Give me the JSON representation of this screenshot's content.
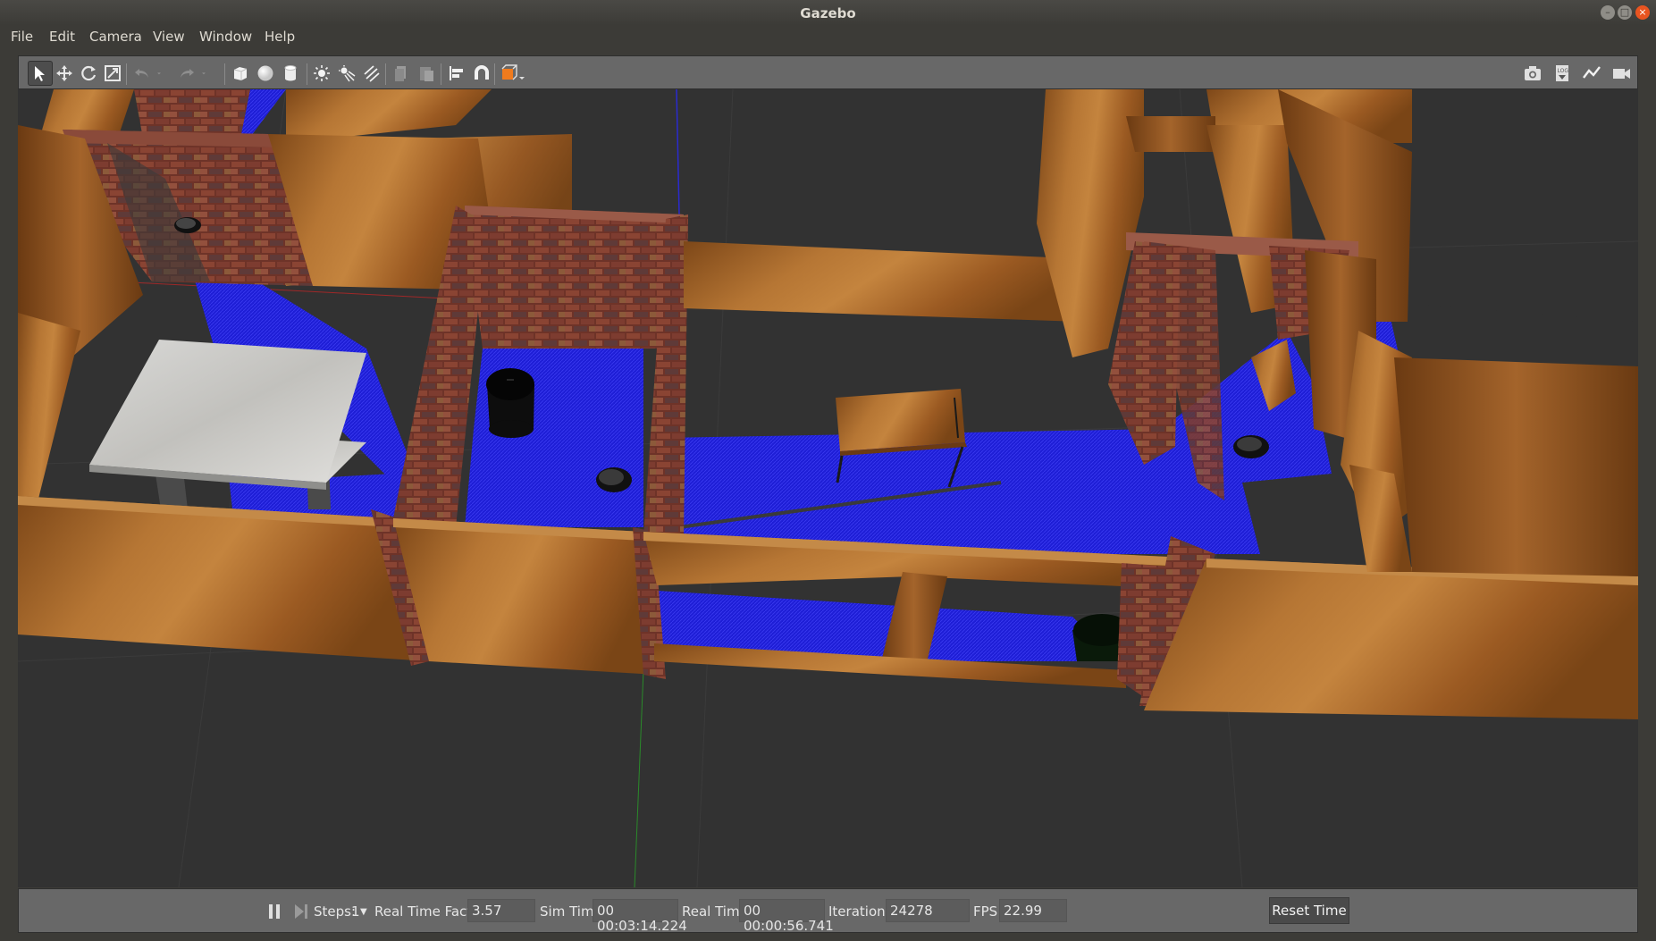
{
  "window": {
    "title": "Gazebo",
    "controls": [
      "minimize-icon",
      "maximize-icon",
      "close-icon"
    ]
  },
  "menu": [
    {
      "label": "File"
    },
    {
      "label": "Edit"
    },
    {
      "label": "Camera"
    },
    {
      "label": "View"
    },
    {
      "label": "Window"
    },
    {
      "label": "Help"
    }
  ],
  "toolbar": {
    "left_tools": [
      "select-arrow-icon",
      "translate-icon",
      "rotate-icon",
      "scale-icon",
      "undo-icon",
      "undo-dropdown-icon",
      "redo-icon",
      "redo-dropdown-icon",
      "box-shape-icon",
      "sphere-shape-icon",
      "cylinder-shape-icon",
      "point-light-icon",
      "spot-light-icon",
      "directional-light-icon",
      "copy-icon",
      "paste-icon",
      "align-icon",
      "snap-magnet-icon",
      "view-angle-icon"
    ],
    "right_tools": [
      "screenshot-icon",
      "log-icon",
      "plot-icon",
      "video-record-icon"
    ]
  },
  "statusbar": {
    "steps_label": "Steps:",
    "steps_value": "1",
    "rtf_label": "Real Time Factor:",
    "rtf_value": "3.57",
    "sim_time_label": "Sim Time:",
    "sim_time_value": "00 00:03:14.224",
    "real_time_label": "Real Time:",
    "real_time_value": "00 00:00:56.741",
    "iterations_label": "Iterations:",
    "iterations_value": "24278",
    "fps_label": "FPS:",
    "fps_value": "22.99",
    "reset_label": "Reset Time"
  },
  "colors": {
    "laser_scan": "#1f1fd8",
    "wood_wall": "#a8652a",
    "brick_wall": "#7a3a2e",
    "ground": "#3a3a3a",
    "accent": "#e95420"
  }
}
